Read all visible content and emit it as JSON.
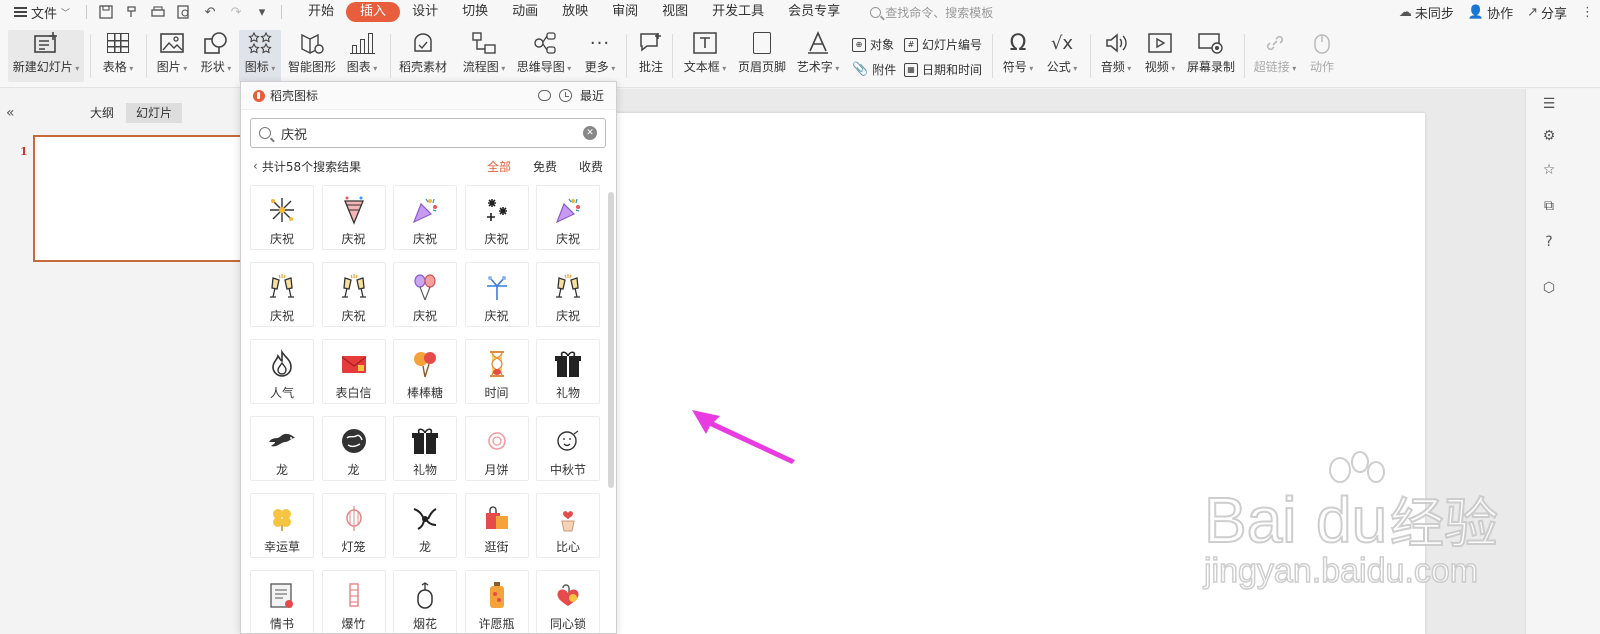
{
  "menubar": {
    "file_label": "文件",
    "tabs": [
      "开始",
      "插入",
      "设计",
      "切换",
      "动画",
      "放映",
      "审阅",
      "视图",
      "开发工具",
      "会员专享"
    ],
    "active_tab": "插入",
    "search_placeholder": "查找命令、搜索模板",
    "sync_label": "未同步",
    "collab_label": "协作",
    "share_label": "分享"
  },
  "ribbon": {
    "new_slide": "新建幻灯片",
    "table": "表格",
    "picture": "图片",
    "shape": "形状",
    "icon": "图标",
    "smart_art": "智能图形",
    "chart": "图表",
    "docer_material": "稻壳素材",
    "flowchart": "流程图",
    "mindmap": "思维导图",
    "more": "更多",
    "comment": "批注",
    "textbox": "文本框",
    "header_footer": "页眉页脚",
    "wordart": "艺术字",
    "object": "对象",
    "attachment": "附件",
    "slide_number": "幻灯片编号",
    "datetime": "日期和时间",
    "symbol": "符号",
    "formula": "公式",
    "audio": "音频",
    "video": "视频",
    "screen_record": "屏幕录制",
    "hyperlink": "超链接",
    "action": "动作"
  },
  "left_pane": {
    "outline_tab": "大纲",
    "slides_tab": "幻灯片",
    "slide_number": "1"
  },
  "icon_panel": {
    "title": "稻壳图标",
    "recent": "最近",
    "search_value": "庆祝",
    "results_text": "共计58个搜索结果",
    "filters": [
      "全部",
      "免费",
      "收费"
    ],
    "active_filter": "全部",
    "items": [
      {
        "label": "庆祝",
        "icon": "fireworks-icon"
      },
      {
        "label": "庆祝",
        "icon": "party-cone-icon"
      },
      {
        "label": "庆祝",
        "icon": "party-popper-icon"
      },
      {
        "label": "庆祝",
        "icon": "fireworks-burst-icon"
      },
      {
        "label": "庆祝",
        "icon": "party-popper-icon"
      },
      {
        "label": "庆祝",
        "icon": "champagne-toast-icon"
      },
      {
        "label": "庆祝",
        "icon": "champagne-toast-icon"
      },
      {
        "label": "庆祝",
        "icon": "balloons-icon"
      },
      {
        "label": "庆祝",
        "icon": "fireworks-blue-icon"
      },
      {
        "label": "庆祝",
        "icon": "champagne-toast-icon"
      },
      {
        "label": "人气",
        "icon": "flame-icon"
      },
      {
        "label": "表白信",
        "icon": "love-letter-icon"
      },
      {
        "label": "棒棒糖",
        "icon": "lollipop-icon"
      },
      {
        "label": "时间",
        "icon": "hourglass-icon"
      },
      {
        "label": "礼物",
        "icon": "gift-icon"
      },
      {
        "label": "龙",
        "icon": "dragon-icon"
      },
      {
        "label": "龙",
        "icon": "dragon-round-icon"
      },
      {
        "label": "礼物",
        "icon": "gift-icon"
      },
      {
        "label": "月饼",
        "icon": "mooncake-icon"
      },
      {
        "label": "中秋节",
        "icon": "mooncake-face-icon"
      },
      {
        "label": "幸运草",
        "icon": "clover-icon"
      },
      {
        "label": "灯笼",
        "icon": "lantern-icon"
      },
      {
        "label": "龙",
        "icon": "dragon-head-icon"
      },
      {
        "label": "逛街",
        "icon": "shopping-bag-icon"
      },
      {
        "label": "比心",
        "icon": "finger-heart-icon"
      },
      {
        "label": "情书",
        "icon": "letter-icon"
      },
      {
        "label": "爆竹",
        "icon": "firecracker-icon"
      },
      {
        "label": "烟花",
        "icon": "firework-tube-icon"
      },
      {
        "label": "许愿瓶",
        "icon": "wish-bottle-icon"
      },
      {
        "label": "同心锁",
        "icon": "heart-lock-icon"
      }
    ]
  },
  "colors": {
    "accent": "#e85d3b",
    "arrow": "#e83ce0",
    "thumb_border": "#c8693a"
  }
}
